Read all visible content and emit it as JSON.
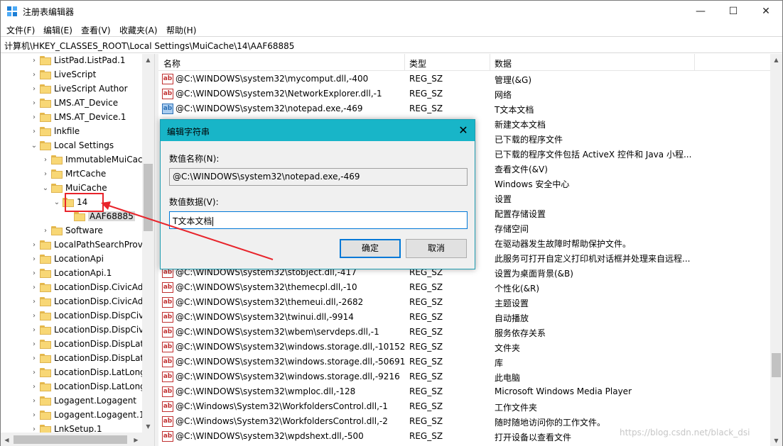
{
  "window": {
    "title": "注册表编辑器",
    "min_glyph": "—",
    "max_glyph": "☐",
    "close_glyph": "✕"
  },
  "menu": [
    "文件(F)",
    "编辑(E)",
    "查看(V)",
    "收藏夹(A)",
    "帮助(H)"
  ],
  "address": "计算机\\HKEY_CLASSES_ROOT\\Local Settings\\MuiCache\\14\\AAF68885",
  "tree": {
    "items": [
      {
        "label": "ListPad.ListPad.1",
        "arrow": "›"
      },
      {
        "label": "LiveScript",
        "arrow": "›"
      },
      {
        "label": "LiveScript Author",
        "arrow": "›"
      },
      {
        "label": "LMS.AT_Device",
        "arrow": "›"
      },
      {
        "label": "LMS.AT_Device.1",
        "arrow": "›"
      },
      {
        "label": "lnkfile",
        "arrow": "›"
      },
      {
        "label": "Local Settings",
        "arrow": "⌄"
      },
      {
        "label": "ImmutableMuiCach",
        "arrow": "›"
      },
      {
        "label": "MrtCache",
        "arrow": "›"
      },
      {
        "label": "MuiCache",
        "arrow": "⌄"
      },
      {
        "label": "14",
        "arrow": "⌄"
      },
      {
        "label": "AAF68885",
        "arrow": ""
      },
      {
        "label": "Software",
        "arrow": "›"
      },
      {
        "label": "LocalPathSearchProvi",
        "arrow": "›"
      },
      {
        "label": "LocationApi",
        "arrow": "›"
      },
      {
        "label": "LocationApi.1",
        "arrow": "›"
      },
      {
        "label": "LocationDisp.CivicAdd",
        "arrow": "›"
      },
      {
        "label": "LocationDisp.CivicAdd",
        "arrow": "›"
      },
      {
        "label": "LocationDisp.DispCivi",
        "arrow": "›"
      },
      {
        "label": "LocationDisp.DispCivi",
        "arrow": "›"
      },
      {
        "label": "LocationDisp.DispLatL",
        "arrow": "›"
      },
      {
        "label": "LocationDisp.DispLatL",
        "arrow": "›"
      },
      {
        "label": "LocationDisp.LatLong",
        "arrow": "›"
      },
      {
        "label": "LocationDisp.LatLong",
        "arrow": "›"
      },
      {
        "label": "Logagent.Logagent",
        "arrow": "›"
      },
      {
        "label": "Logagent.Logagent.1",
        "arrow": "›"
      },
      {
        "label": "LnkSetup.1",
        "arrow": "›"
      }
    ]
  },
  "columns": {
    "name": "名称",
    "type": "类型",
    "data": "数据"
  },
  "values": [
    {
      "name": "@C:\\WINDOWS\\system32\\mycomput.dll,-400",
      "type": "REG_SZ",
      "data": "管理(&G)",
      "icon": "ab"
    },
    {
      "name": "@C:\\WINDOWS\\system32\\NetworkExplorer.dll,-1",
      "type": "REG_SZ",
      "data": "网络",
      "icon": "ab"
    },
    {
      "name": "@C:\\WINDOWS\\system32\\notepad.exe,-469",
      "type": "REG_SZ",
      "data": "T文本文档",
      "icon": "ab",
      "selected": true
    },
    {
      "name": "",
      "type": "",
      "data": "新建文本文档",
      "icon": ""
    },
    {
      "name": "",
      "type": "",
      "data": "已下载的程序文件",
      "icon": ""
    },
    {
      "name": "",
      "type": "",
      "data": "已下载的程序文件包括 ActiveX 控件和 Java 小程...",
      "icon": ""
    },
    {
      "name": "",
      "type": "",
      "data": "查看文件(&V)",
      "icon": ""
    },
    {
      "name": "",
      "type": "",
      "data": "Windows 安全中心",
      "icon": ""
    },
    {
      "name": "",
      "type": "",
      "data": "设置",
      "icon": ""
    },
    {
      "name": "",
      "type": "",
      "data": "配置存储设置",
      "icon": ""
    },
    {
      "name": "",
      "type": "",
      "data": "存储空间",
      "icon": ""
    },
    {
      "name": "",
      "type": "",
      "data": "在驱动器发生故障时帮助保护文件。",
      "icon": ""
    },
    {
      "name": "",
      "type": "",
      "data": "此服务可打开自定义打印机对话框并处理来自远程...",
      "icon": ""
    },
    {
      "name": "@C:\\WINDOWS\\system32\\stobject.dll,-417",
      "type": "REG_SZ",
      "data": "设置为桌面背景(&B)",
      "icon": "ab"
    },
    {
      "name": "@C:\\WINDOWS\\system32\\themecpl.dll,-10",
      "type": "REG_SZ",
      "data": "个性化(&R)",
      "icon": "ab"
    },
    {
      "name": "@C:\\WINDOWS\\system32\\themeui.dll,-2682",
      "type": "REG_SZ",
      "data": "主题设置",
      "icon": "ab"
    },
    {
      "name": "@C:\\WINDOWS\\system32\\twinui.dll,-9914",
      "type": "REG_SZ",
      "data": "自动播放",
      "icon": "ab"
    },
    {
      "name": "@C:\\WINDOWS\\system32\\wbem\\servdeps.dll,-1",
      "type": "REG_SZ",
      "data": "服务依存关系",
      "icon": "ab"
    },
    {
      "name": "@C:\\WINDOWS\\system32\\windows.storage.dll,-10152",
      "type": "REG_SZ",
      "data": "文件夹",
      "icon": "ab"
    },
    {
      "name": "@C:\\WINDOWS\\system32\\windows.storage.dll,-50691",
      "type": "REG_SZ",
      "data": "库",
      "icon": "ab"
    },
    {
      "name": "@C:\\WINDOWS\\system32\\windows.storage.dll,-9216",
      "type": "REG_SZ",
      "data": "此电脑",
      "icon": "ab"
    },
    {
      "name": "@C:\\WINDOWS\\system32\\wmploc.dll,-128",
      "type": "REG_SZ",
      "data": "Microsoft Windows Media Player",
      "icon": "ab"
    },
    {
      "name": "@C:\\Windows\\System32\\WorkfoldersControl.dll,-1",
      "type": "REG_SZ",
      "data": "工作文件夹",
      "icon": "ab"
    },
    {
      "name": "@C:\\Windows\\System32\\WorkfoldersControl.dll,-2",
      "type": "REG_SZ",
      "data": "随时随地访问你的工作文件。",
      "icon": "ab"
    },
    {
      "name": "@C:\\WINDOWS\\system32\\wpdshext.dll,-500",
      "type": "REG_SZ",
      "data": "打开设备以查看文件",
      "icon": "ab"
    }
  ],
  "dialog": {
    "title": "编辑字符串",
    "close_glyph": "✕",
    "name_label": "数值名称(N):",
    "name_value": "@C:\\WINDOWS\\system32\\notepad.exe,-469",
    "data_label": "数值数据(V):",
    "data_value": "T文本文档",
    "ok": "确定",
    "cancel": "取消"
  },
  "watermark": "https://blog.csdn.net/black_dsi",
  "colors": {
    "accent": "#18b5c8",
    "annotation": "#e8242b",
    "button_focus": "#0078d7"
  }
}
